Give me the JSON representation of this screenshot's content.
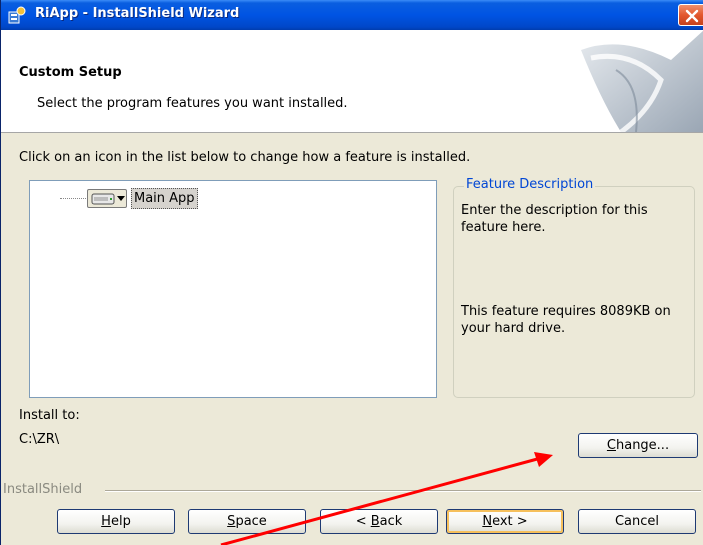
{
  "window": {
    "title": "RiApp - InstallShield Wizard",
    "close_icon": "close-icon"
  },
  "header": {
    "title": "Custom Setup",
    "subtitle": "Select the program features you want installed."
  },
  "main": {
    "instruction": "Click on an icon in the list below to change how a feature is installed.",
    "tree": {
      "items": [
        {
          "label": "Main App",
          "icon": "drive-icon"
        }
      ]
    },
    "description": {
      "legend": "Feature Description",
      "text": "Enter the description for this feature here.",
      "requirement": "This feature requires 8089KB on your hard drive."
    },
    "install": {
      "label": "Install to:",
      "path": "C:\\ZR\\"
    },
    "change_button": {
      "mnemonic": "C",
      "rest": "hange..."
    }
  },
  "footer": {
    "brand": "InstallShield",
    "buttons": {
      "help": {
        "mnemonic": "H",
        "rest": "elp"
      },
      "space": {
        "mnemonic": "S",
        "rest": "pace"
      },
      "back": {
        "prefix": "< ",
        "mnemonic": "B",
        "rest": "ack"
      },
      "next": {
        "mnemonic": "N",
        "rest": "ext >"
      },
      "cancel": {
        "label": "Cancel"
      }
    }
  },
  "colors": {
    "title_bar": "#0054e3",
    "legend_text": "#0046d5",
    "annotation_arrow": "#ff0000"
  }
}
